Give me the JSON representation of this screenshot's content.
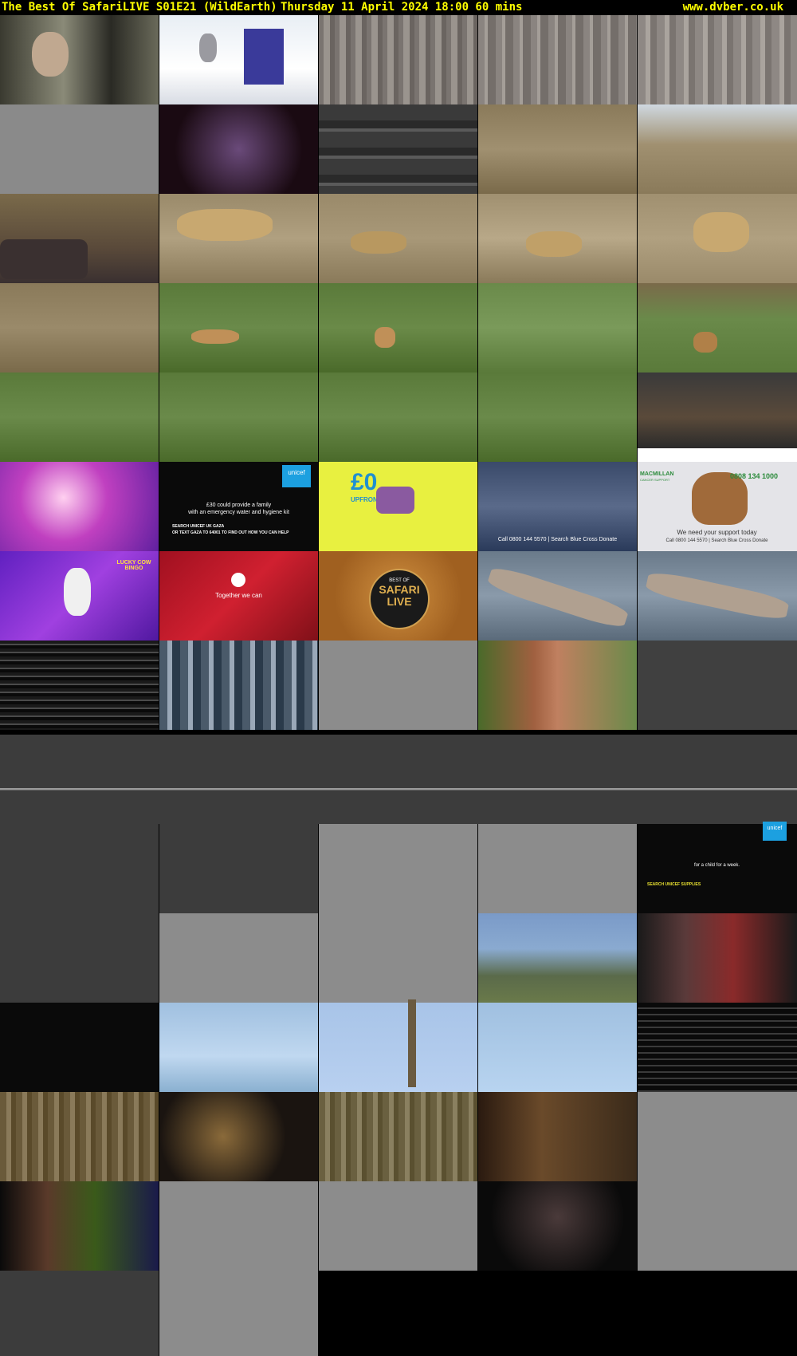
{
  "header": {
    "title": "The Best Of SafariLIVE S01E21 (WildEarth)",
    "date_time_duration": "Thursday 11 April 2024  18:00  60 mins",
    "site": "www.dvber.co.uk"
  },
  "thumbnails": [
    {
      "name": "thumb-women-closeup",
      "bg": "linear-gradient(90deg,#3a3a30,#8a8a78 40%,#2a2a24 70%,#6a6a5a)"
    },
    {
      "name": "thumb-cat-food-ad",
      "bg": "linear-gradient(180deg,#e8eef4,#ffffff 60%,#d8dce4)"
    },
    {
      "name": "thumb-glitch-grey-1",
      "bg": "repeating-linear-gradient(90deg,#7a7470 0 6px,#9a948e 6px 14px,#6a6460 14px 20px)"
    },
    {
      "name": "thumb-glitch-grey-2",
      "bg": "repeating-linear-gradient(90deg,#8a8480 0 8px,#a49e98 8px 12px,#746e6a 12px 22px)"
    },
    {
      "name": "thumb-glitch-grey-3",
      "bg": "repeating-linear-gradient(90deg,#8e8884 0 10px,#aaa49e 10px 16px,#7a7470 16px 24px)"
    },
    {
      "name": "thumb-grey-noise-1",
      "bg": "#8a8a8a"
    },
    {
      "name": "thumb-man-at-desk",
      "bg": "radial-gradient(circle at 50% 50%,#6a4a7a,#1a0a12 70%)"
    },
    {
      "name": "thumb-dark-glitch-1",
      "bg": "repeating-linear-gradient(180deg,#3a3a3a 0 20px,#2a2a2a 20px 30px,#5a5a5a 30px 34px)"
    },
    {
      "name": "thumb-savanna-road-1",
      "bg": "linear-gradient(180deg,#8a7a5a,#a09070 50%,#7a6a4a)"
    },
    {
      "name": "thumb-savanna-tree",
      "bg": "linear-gradient(180deg,#cfd8e0,#a09070 45%,#8a7a5a)"
    },
    {
      "name": "thumb-vehicle-hat",
      "bg": "linear-gradient(180deg,#7a6a4a,#5a4a3a 60%,#3a3030)"
    },
    {
      "name": "thumb-leopard-1",
      "bg": "linear-gradient(180deg,#9a8a6a,#b0a080 50%,#8a7a5a)"
    },
    {
      "name": "thumb-leopard-2",
      "bg": "linear-gradient(180deg,#9a8a6a,#a89878 50%,#8a7a5a)"
    },
    {
      "name": "thumb-leopard-3",
      "bg": "linear-gradient(180deg,#a09070,#b8a888 50%,#8a7a5a)"
    },
    {
      "name": "thumb-leopard-4",
      "bg": "linear-gradient(180deg,#a09070,#b0a080 50%,#9a8a6a)"
    },
    {
      "name": "thumb-dry-grass",
      "bg": "linear-gradient(180deg,#8a7a5a,#9a8a6a 50%,#7a6a4a)"
    },
    {
      "name": "thumb-mongoose-1",
      "bg": "linear-gradient(180deg,#5a7a3a,#6a8a4a 50%,#4a6a2a)"
    },
    {
      "name": "thumb-mongoose-2",
      "bg": "linear-gradient(180deg,#5a7a3a,#6a8a48 50%,#4a6a2a)"
    },
    {
      "name": "thumb-green-road",
      "bg": "linear-gradient(180deg,#6a8a4a,#7a9a5a 50%,#5a7a3a)"
    },
    {
      "name": "thumb-mongoose-3",
      "bg": "linear-gradient(180deg,#7a6a4a,#6a8a4a 40%,#5a7a3a)"
    },
    {
      "name": "thumb-mongoose-4",
      "bg": "linear-gradient(180deg,#5a7a3a,#6a8a4a 50%,#4a6a2a)"
    },
    {
      "name": "thumb-mongoose-5",
      "bg": "linear-gradient(180deg,#5a7a3a,#6a8a4a 50%,#4a6a2a)"
    },
    {
      "name": "thumb-mongoose-6",
      "bg": "linear-gradient(180deg,#5a7a3a,#6a8a4a 50%,#4a6a2a)"
    },
    {
      "name": "thumb-mongoose-7",
      "bg": "linear-gradient(180deg,#5a7a3a,#6a8a4a 50%,#4a6a2a)"
    },
    {
      "name": "thumb-macmillan-ad",
      "bg": "linear-gradient(180deg,#3a3a3a,#5a4a3a 50%,#2a2a2a 85%,#ffffff 85%)"
    },
    {
      "name": "thumb-bingo-pink",
      "bg": "radial-gradient(circle at 40% 40%,#ffd0f0,#c040c0 40%,#6020a0)"
    },
    {
      "name": "thumb-unicef-gaza",
      "bg": "#0a0a0a"
    },
    {
      "name": "thumb-zero-upfront",
      "bg": "#e8f040"
    },
    {
      "name": "thumb-blue-cross-1",
      "bg": "linear-gradient(180deg,#3a4a6a,#5a6a8a 50%,#2a3a5a)"
    },
    {
      "name": "thumb-blue-cross-dog",
      "bg": "#e4e4e8"
    },
    {
      "name": "thumb-lucky-bingo",
      "bg": "linear-gradient(135deg,#6020c0,#a040e0 50%,#5018a0)"
    },
    {
      "name": "thumb-vodafone",
      "bg": "linear-gradient(135deg,#a01020,#d02030 50%,#801018)"
    },
    {
      "name": "thumb-safari-live-logo",
      "bg": "radial-gradient(circle at 50% 50%,#d09040,#a06020 70%)"
    },
    {
      "name": "thumb-birds-log-1",
      "bg": "linear-gradient(180deg,#6a7a8a,#8a9aaa 50%,#5a6a7a)"
    },
    {
      "name": "thumb-birds-log-2",
      "bg": "linear-gradient(180deg,#6a7a8a,#8a9aaa 50%,#5a6a7a)"
    },
    {
      "name": "thumb-black-noise",
      "bg": "repeating-linear-gradient(180deg,#1a1a1a 0 4px,#4a4a4a 4px 6px,#0a0a0a 6px 10px)"
    },
    {
      "name": "thumb-blue-streaks",
      "bg": "repeating-linear-gradient(90deg,#4a5a6a 0 10px,#9aa8b8 10px 16px,#2a3a4a 16px 26px)"
    },
    {
      "name": "thumb-grey-plain-1",
      "bg": "#8c8c8c"
    },
    {
      "name": "thumb-copper-streaks",
      "bg": "linear-gradient(90deg,#4a6a2a,#a06040 35%,#c08060 50%,#6a8a4a)"
    },
    {
      "name": "thumb-dark-grey-1",
      "bg": "#404040"
    },
    {
      "name": "thumb-grey-glitch-a",
      "bg": "#3c3c3c"
    },
    {
      "name": "thumb-grey-glitch-b",
      "bg": "#3c3c3c"
    },
    {
      "name": "thumb-grey-plain-2",
      "bg": "#8c8c8c"
    },
    {
      "name": "thumb-grey-plain-3",
      "bg": "#8c8c8c"
    },
    {
      "name": "thumb-unicef-supplies",
      "bg": "#0a0a0a"
    },
    {
      "name": "thumb-dark-grey-2",
      "bg": "#3c3c3c"
    },
    {
      "name": "thumb-grey-lines",
      "bg": "#8c8c8c"
    },
    {
      "name": "thumb-grey-plain-4",
      "bg": "#8c8c8c"
    },
    {
      "name": "thumb-lake-glitch",
      "bg": "linear-gradient(180deg,#7a9ac8,#8aaad0 40%,#5a6a4a 70%,#6a7a4a)"
    },
    {
      "name": "thumb-red-glitch",
      "bg": "linear-gradient(90deg,#1a1a1a,#5a3a3a 30%,#8a2a2a 60%,#1a1a1a)"
    },
    {
      "name": "thumb-black-glitch",
      "bg": "#0a0a0a"
    },
    {
      "name": "thumb-sky-glitch",
      "bg": "linear-gradient(180deg,#a0c0e0,#c0d8f0 60%,#8ab0d0)"
    },
    {
      "name": "thumb-sky-tree",
      "bg": "linear-gradient(180deg,#a8c4e8,#b8d0f0)"
    },
    {
      "name": "thumb-sky-plain",
      "bg": "linear-gradient(180deg,#a0c0e0,#b8d4f0)"
    },
    {
      "name": "thumb-black-lines",
      "bg": "repeating-linear-gradient(180deg,#0a0a0a 0 6px,#3a3a3a 6px 8px)"
    },
    {
      "name": "thumb-brown-streaks",
      "bg": "repeating-linear-gradient(90deg,#6a5a3a 0 8px,#8a7a5a 8px 14px,#5a4a2a 14px 20px)"
    },
    {
      "name": "thumb-night-scene",
      "bg": "radial-gradient(circle at 40% 50%,#8a6a3a,#1a1410 60%)"
    },
    {
      "name": "thumb-olive-streaks",
      "bg": "repeating-linear-gradient(90deg,#6a6040 0 8px,#8a8060 8px 14px,#5a5030 14px 20px)"
    },
    {
      "name": "thumb-brown-dark",
      "bg": "linear-gradient(90deg,#2a1a10,#6a4a2a 40%,#3a2a1a)"
    },
    {
      "name": "thumb-grey-plain-5",
      "bg": "#8c8c8c"
    },
    {
      "name": "thumb-green-purple",
      "bg": "linear-gradient(90deg,#0a0a0a,#5a3a2a 30%,#3a5a1a 60%,#1a1a4a)"
    },
    {
      "name": "thumb-grey-noise-2",
      "bg": "#8c8c8c"
    },
    {
      "name": "thumb-grey-noise-3",
      "bg": "#8c8c8c"
    },
    {
      "name": "thumb-dark-scene",
      "bg": "radial-gradient(circle at 50% 40%,#4a3a3a,#0a0a0a 70%)"
    },
    {
      "name": "thumb-grey-plain-6",
      "bg": "#8c8c8c"
    },
    {
      "name": "thumb-dark-grey-3",
      "bg": "#3c3c3c"
    },
    {
      "name": "thumb-grey-noise-4",
      "bg": "#8c8c8c"
    }
  ],
  "overlays": {
    "unicef_gaza_line1": "£30 could provide a family",
    "unicef_gaza_line2": "with an emergency water and hygiene kit",
    "unicef_gaza_line3": "SEARCH UNICEF UK GAZA",
    "unicef_gaza_line4": "OR TEXT GAZA TO 64001 TO FIND OUT HOW YOU CAN HELP",
    "zero_upfront": "£0",
    "upfront": "UPFRONT",
    "blue_cross_phone_1": "Call 0800 144 5570 | Search Blue Cross Donate",
    "blue_cross_tag": "We need your support today",
    "blue_cross_phone_2": "Call 0800 144 5570 | Search Blue Cross Donate",
    "vodafone": "Together we can",
    "safari_best_of": "BEST OF",
    "safari_name": "SAFARI",
    "safari_live": "LIVE",
    "macmillan": "MACMILLAN",
    "macmillan_sub": "CANCER SUPPORT",
    "macmillan_phone": "0808 134 1000",
    "unicef_child": "for a child for a week.",
    "unicef_supplies": "SEARCH UNICEF SUPPLIES",
    "lucky_bingo": "LUCKY COW BINGO",
    "unicef_logo": "unicef"
  },
  "colors": {
    "header_text": "#ffff00",
    "header_bg": "#000000"
  }
}
